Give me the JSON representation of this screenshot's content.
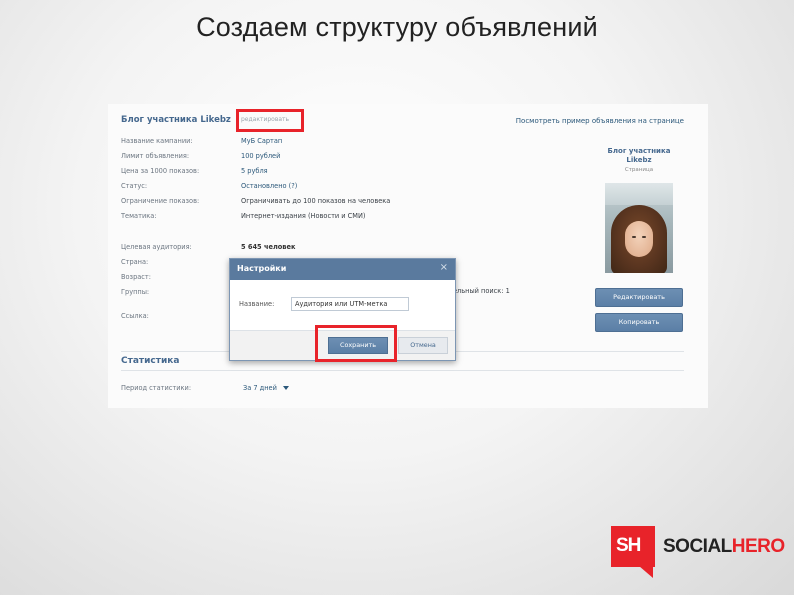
{
  "slide": {
    "title": "Создаем структуру объявлений"
  },
  "ad": {
    "name": "Блог участника Likebz",
    "edit_link": "редактировать",
    "preview_link": "Посмотреть пример объявления на странице",
    "rows": [
      {
        "key": "Название кампании:",
        "value": "МуБ Сартап"
      },
      {
        "key": "Лимит объявления:",
        "value": "100 рублей"
      },
      {
        "key": "Цена за 1000 показов:",
        "value": "5 рубля"
      },
      {
        "key": "Статус:",
        "value": "Остановлено (?)"
      },
      {
        "key": "Ограничение показов:",
        "value": "Ограничивать до 100 показов на человека"
      },
      {
        "key": "Тематика:",
        "value": "Интернет-издания (Новости и СМИ)"
      },
      {
        "key": "Целевая аудитория:",
        "value": "5 645 человек"
      },
      {
        "key": "Страна:",
        "value": ""
      },
      {
        "key": "Возраст:",
        "value": ""
      },
      {
        "key": "Группы:",
        "value": ""
      },
      {
        "key": "Ссылка:",
        "value": ""
      }
    ],
    "groups_overflow_text": "ельный поиск: 1"
  },
  "preview": {
    "title": "Блог участника Likebz",
    "subtitle": "Страница",
    "edit_button": "Редактировать",
    "copy_button": "Копировать"
  },
  "stats": {
    "title": "Статистика",
    "period_label": "Период статистики:",
    "period_value": "За 7 дней"
  },
  "modal": {
    "title": "Настройки",
    "close": "×",
    "name_label": "Название:",
    "name_value": "Аудитория или UTM-метка",
    "save_button": "Сохранить",
    "cancel_button": "Отмена"
  },
  "logo": {
    "sh": "SH",
    "social": "SOCIAL",
    "hero": "HERO"
  },
  "colors": {
    "accent": "#e8232a",
    "vk_blue": "#5b7fa6",
    "link": "#2b587a"
  }
}
